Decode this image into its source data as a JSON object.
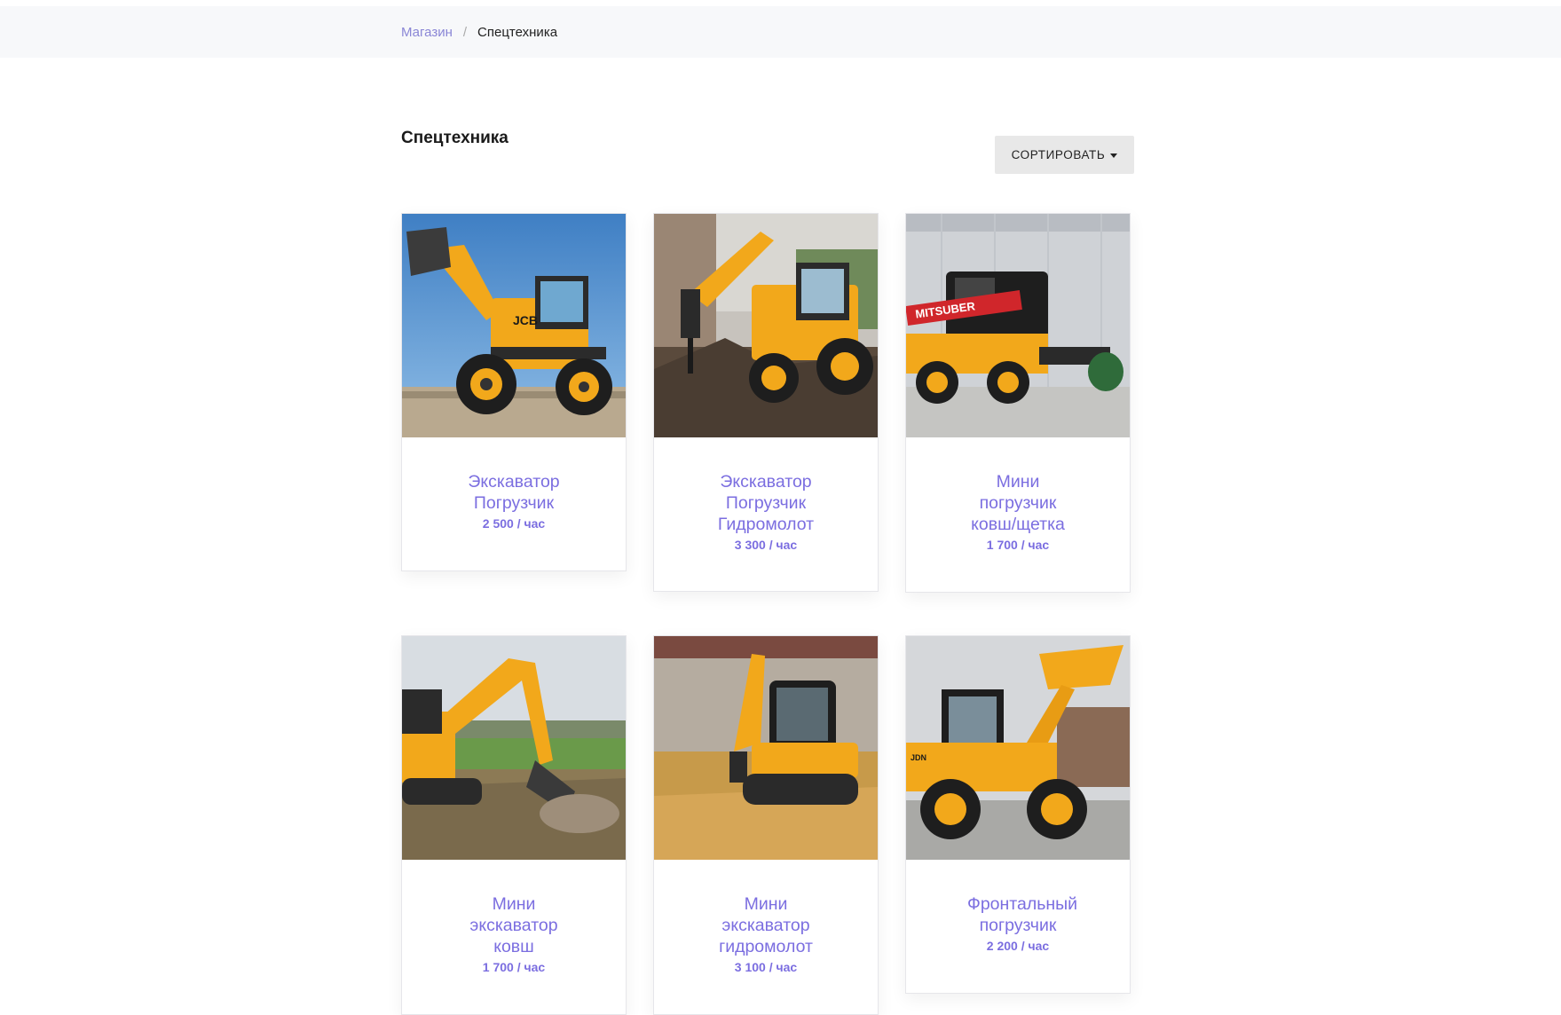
{
  "breadcrumb": {
    "home_label": "Магазин",
    "separator": "/",
    "current_label": "Спецтехника"
  },
  "page": {
    "title": "Спецтехника",
    "sort_label": "СОРТИРОВАТЬ"
  },
  "products": [
    {
      "title": "Экскаватор Погрузчик",
      "price": "2 500 / час",
      "image": "backhoe-loader"
    },
    {
      "title": "Экскаватор Погрузчик Гидромолот",
      "price": "3 300 / час",
      "image": "backhoe-hammer"
    },
    {
      "title": "Мини погрузчик ковш/щетка",
      "price": "1 700 / час",
      "image": "skid-steer"
    },
    {
      "title": "Мини экскаватор ковш",
      "price": "1 700 / час",
      "image": "mini-excavator"
    },
    {
      "title": "Мини экскаватор гидромолот",
      "price": "3 100 / час",
      "image": "mini-excavator-water"
    },
    {
      "title": "Фронтальный погрузчик",
      "price": "2 200 / час",
      "image": "wheel-loader"
    }
  ],
  "colors": {
    "accent": "#7b6ee0",
    "machine_yellow": "#f2a81b"
  }
}
